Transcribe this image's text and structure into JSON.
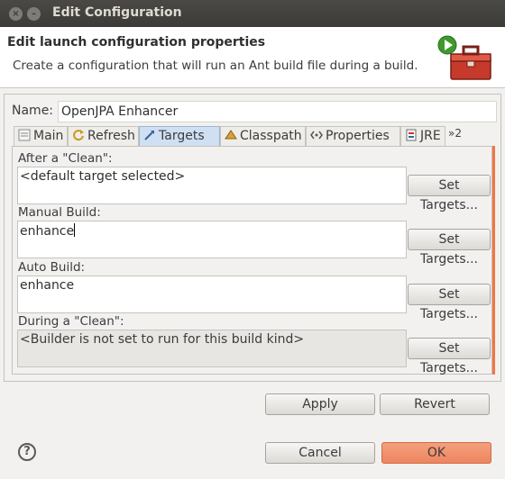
{
  "window": {
    "title": "Edit Configuration"
  },
  "header": {
    "title": "Edit launch configuration properties",
    "description": "Create a configuration that will run an Ant build file during a build."
  },
  "name": {
    "label": "Name:",
    "value": "OpenJPA Enhancer"
  },
  "tabs": [
    {
      "label": "Main",
      "icon": "main-tab-icon"
    },
    {
      "label": "Refresh",
      "icon": "refresh-icon"
    },
    {
      "label": "Targets",
      "icon": "targets-icon",
      "active": true
    },
    {
      "label": "Classpath",
      "icon": "classpath-icon"
    },
    {
      "label": "Properties",
      "icon": "properties-icon"
    },
    {
      "label": "JRE",
      "icon": "jre-icon"
    }
  ],
  "tabs_more": "»2",
  "sections": [
    {
      "label": "After a \"Clean\":",
      "value": "<default target selected>",
      "button": "Set Targets..."
    },
    {
      "label": "Manual Build:",
      "value": "enhance",
      "button": "Set Targets..."
    },
    {
      "label": "Auto Build:",
      "value": "enhance",
      "button": "Set Targets..."
    },
    {
      "label": "During a \"Clean\":",
      "value": "<Builder is not set to run for this build kind>",
      "button": "Set Targets..."
    }
  ],
  "buttons": {
    "apply": "Apply",
    "revert": "Revert",
    "cancel": "Cancel",
    "ok": "OK"
  },
  "help": "?",
  "colors": {
    "accent": "#ee8560",
    "active_tab": "#cfe0f3",
    "titlebar": "#3c3b37"
  }
}
